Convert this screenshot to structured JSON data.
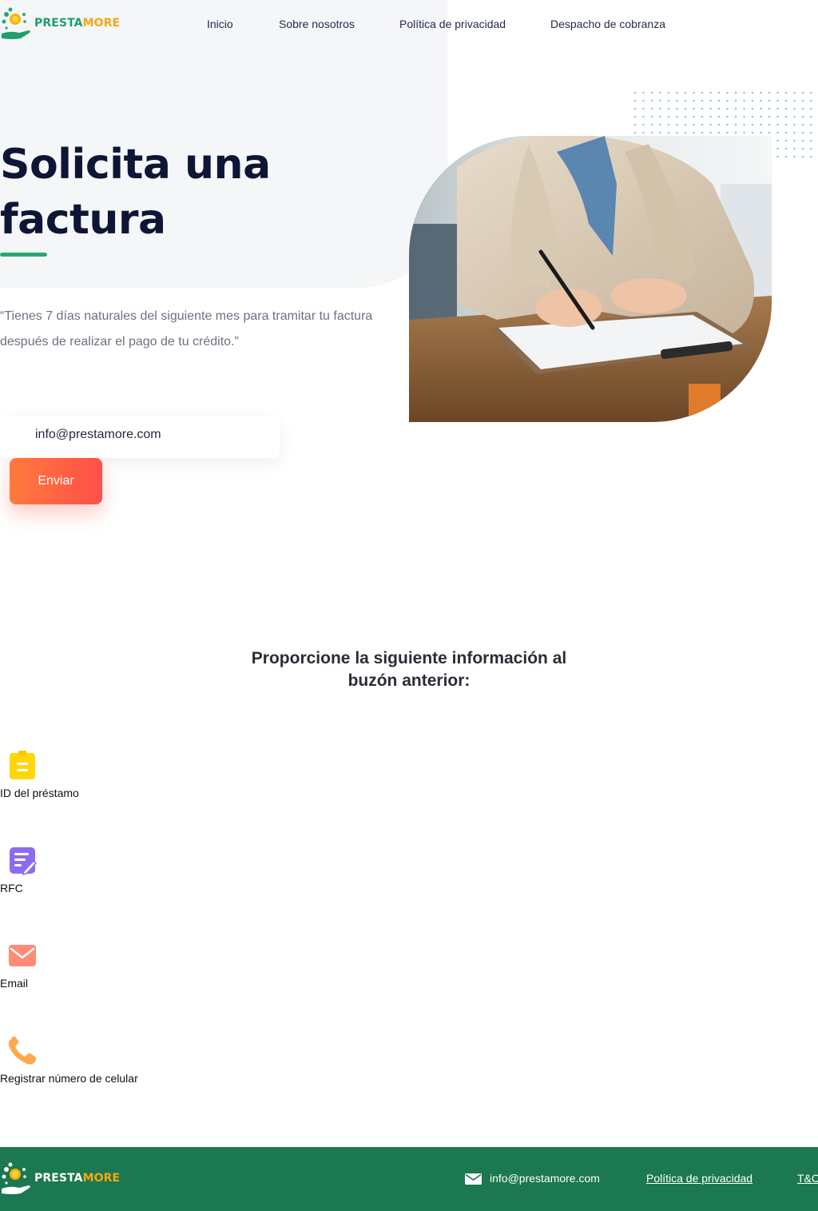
{
  "header": {
    "brand": {
      "part1": "PRESTA",
      "part2": "MORE"
    },
    "nav": [
      {
        "label": "Inicio"
      },
      {
        "label": "Sobre nosotros"
      },
      {
        "label": "Política de privacidad"
      },
      {
        "label": "Despacho de cobranza"
      }
    ]
  },
  "hero": {
    "title_line1": "Solicita una",
    "title_line2": "factura",
    "subtitle": "“Tienes 7 días naturales del siguiente mes para tramitar tu factura después de realizar el pago de tu crédito.”",
    "email": "info@prestamore.com",
    "button_label": "Enviar"
  },
  "instructions": {
    "heading_line1": "Proporcione la siguiente información al",
    "heading_line2": "buzón anterior:",
    "items": [
      {
        "label": "ID del préstamo",
        "icon": "clipboard-icon",
        "color": "#ffd60a"
      },
      {
        "label": "RFC",
        "icon": "edit-document-icon",
        "color": "#8b6cf0"
      },
      {
        "label": "Email",
        "icon": "envelope-icon",
        "color": "#ff8a75"
      },
      {
        "label": "Registrar número de celular",
        "icon": "phone-icon",
        "color": "#ffa94d"
      }
    ]
  },
  "footer": {
    "brand": {
      "part1": "PRESTA",
      "part2": "MORE"
    },
    "email": "info@prestamore.com",
    "links": [
      {
        "label": "Política de privacidad"
      },
      {
        "label": "T&C"
      }
    ],
    "background": "#1b7850"
  },
  "colors": {
    "brand_green": "#1e9f6b",
    "brand_orange": "#f5a712",
    "accent_gradient_start": "#ff7a3a",
    "accent_gradient_end": "#ff4f4b",
    "title": "#0e1635"
  }
}
